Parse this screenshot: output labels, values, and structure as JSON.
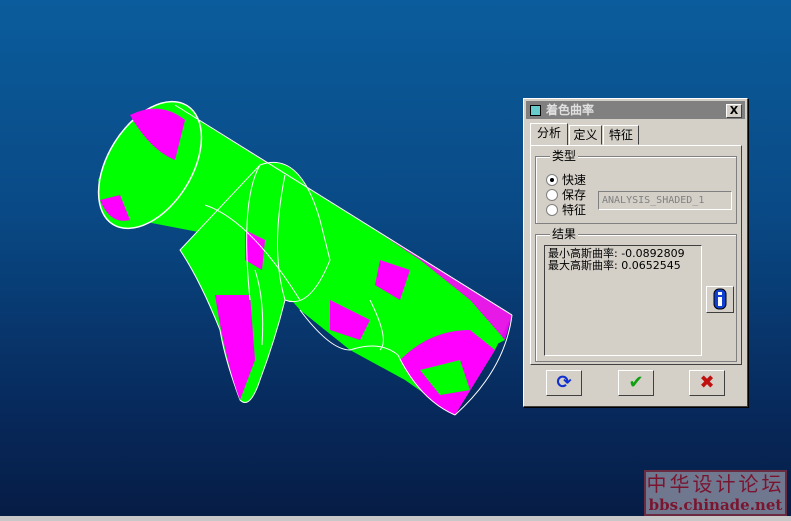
{
  "dialog": {
    "title": "着色曲率",
    "close_label": "X",
    "tabs": [
      "分析",
      "定义",
      "特征"
    ],
    "type_group": {
      "label": "类型",
      "options": [
        {
          "label": "快速",
          "selected": true
        },
        {
          "label": "保存",
          "selected": false
        },
        {
          "label": "特征",
          "selected": false
        }
      ],
      "name_value": "ANALYSIS_SHADED_1"
    },
    "results_group": {
      "label": "结果",
      "lines": [
        "最小高斯曲率: -0.0892809",
        "最大高斯曲率: 0.0652545"
      ]
    },
    "buttons": {
      "refresh_icon": "refresh-icon",
      "ok_icon": "check-icon",
      "cancel_icon": "x-icon",
      "info_icon": "info-icon"
    }
  },
  "colors": {
    "positive": "#00ff00",
    "negative": "#ff00ff",
    "background": "#0b5c9c"
  },
  "watermark": {
    "title": "中华设计论坛",
    "url": "bbs.chinade.net"
  }
}
